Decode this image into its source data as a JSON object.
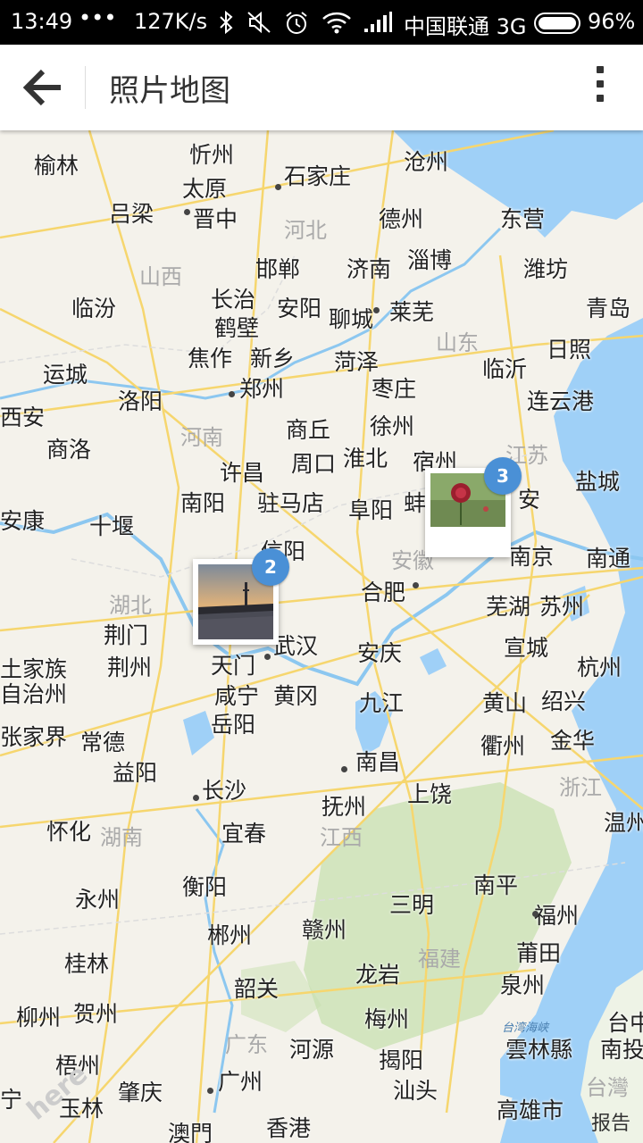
{
  "status_bar": {
    "time": "13:49",
    "dots": "•••",
    "speed": "127K/s",
    "carrier": "中国联通 3G",
    "battery": "96%"
  },
  "app_bar": {
    "title": "照片地图"
  },
  "icons": {
    "back": "back-arrow-icon",
    "menu": "more-vert-icon"
  },
  "colors": {
    "accent": "#4a90d6",
    "water": "#9fd0f7",
    "land": "#f3f1ea",
    "forest": "#c8e0b0",
    "road": "#f6d66e"
  },
  "map": {
    "cities": [
      "榆林",
      "忻州",
      "太原",
      "石家庄",
      "沧州",
      "吕梁",
      "晋中",
      "德州",
      "东营",
      "邯郸",
      "济南",
      "淄博",
      "潍坊",
      "临汾",
      "长治",
      "安阳",
      "莱芜",
      "青岛",
      "鹤壁",
      "聊城",
      "日照",
      "焦作",
      "新乡",
      "菏泽",
      "运城",
      "洛阳",
      "郑州",
      "枣庄",
      "临沂",
      "连云港",
      "西安",
      "商丘",
      "徐州",
      "商洛",
      "淮北",
      "宿州",
      "盐城",
      "许昌",
      "周口",
      "南阳",
      "驻马店",
      "阜阳",
      "蚌",
      "安",
      "安康",
      "十堰",
      "信阳",
      "南京",
      "南通",
      "合肥",
      "芜湖",
      "苏州",
      "荆门",
      "武汉",
      "安庆",
      "宣城",
      "土家族",
      "自治州",
      "荆州",
      "天门",
      "杭州",
      "咸宁",
      "黄冈",
      "九江",
      "黄山",
      "绍兴",
      "张家界",
      "常德",
      "岳阳",
      "衢州",
      "金华",
      "益阳",
      "南昌",
      "长沙",
      "抚州",
      "上饶",
      "温州",
      "怀化",
      "宜春",
      "衡阳",
      "南平",
      "永州",
      "三明",
      "福州",
      "郴州",
      "赣州",
      "莆田",
      "桂林",
      "龙岩",
      "泉州",
      "韶关",
      "柳州",
      "贺州",
      "梅州",
      "雲林縣",
      "南投",
      "河源",
      "梧州",
      "揭阳",
      "肇庆",
      "汕头",
      "广州",
      "高雄市",
      "宁",
      "玉林",
      "澳門",
      "香港",
      "台中"
    ],
    "provinces": [
      "河北",
      "山西",
      "山东",
      "河南",
      "江苏",
      "安徽",
      "湖北",
      "浙江",
      "湖南",
      "江西",
      "福建",
      "广东",
      "台灣"
    ],
    "water_labels": [
      "台湾海峡"
    ],
    "watermark": "here",
    "report": "报告"
  },
  "clusters": [
    {
      "name": "cluster-2",
      "count": "2",
      "photo": "bridge-sunset"
    },
    {
      "name": "cluster-3",
      "count": "3",
      "photo": "red-rose"
    }
  ]
}
